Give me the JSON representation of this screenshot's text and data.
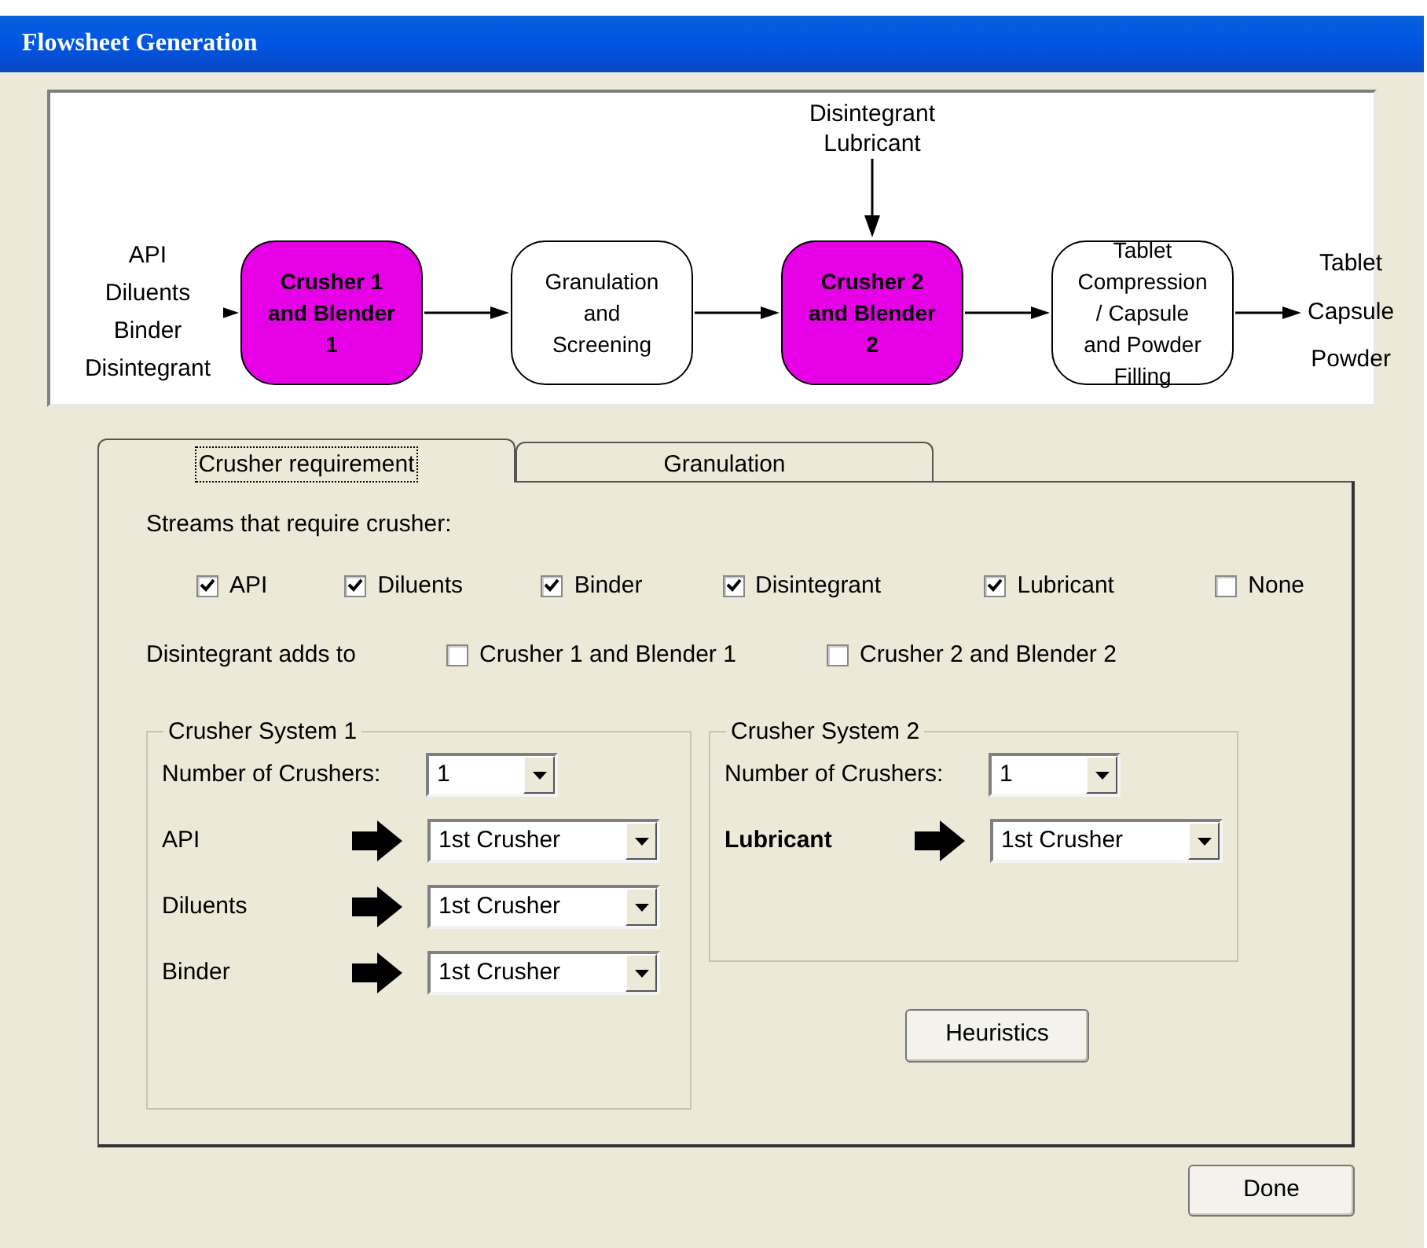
{
  "window": {
    "title": "Flowsheet Generation"
  },
  "flowsheet": {
    "inputs": [
      "API",
      "Diluents",
      "Binder",
      "Disintegrant"
    ],
    "nodes": [
      {
        "label": "Crusher 1 and Blender 1",
        "color": "#e600e6"
      },
      {
        "label": "Granulation and Screening",
        "color": "#ffffff"
      },
      {
        "label": "Crusher 2 and Blender 2",
        "color": "#e600e6",
        "top_inputs": [
          "Disintegrant",
          "Lubricant"
        ]
      },
      {
        "label": "Tablet Compression / Capsule and Powder Filling",
        "color": "#ffffff"
      }
    ],
    "outputs": [
      "Tablet",
      "Capsule",
      "Powder"
    ]
  },
  "tabs": [
    {
      "label": "Crusher requirement",
      "selected": true
    },
    {
      "label": "Granulation",
      "selected": false
    }
  ],
  "streams": {
    "label": "Streams that require crusher:",
    "options": [
      {
        "label": "API",
        "checked": true
      },
      {
        "label": "Diluents",
        "checked": true
      },
      {
        "label": "Binder",
        "checked": true
      },
      {
        "label": "Disintegrant",
        "checked": true
      },
      {
        "label": "Lubricant",
        "checked": true
      },
      {
        "label": "None",
        "checked": false
      }
    ]
  },
  "disintegrant_adds_to": {
    "label": "Disintegrant adds to",
    "options": [
      {
        "label": "Crusher 1 and Blender 1",
        "checked": false
      },
      {
        "label": "Crusher 2 and Blender 2",
        "checked": false
      }
    ]
  },
  "crusher_systems": [
    {
      "title": "Crusher System 1",
      "count_label": "Number of Crushers:",
      "count": "1",
      "assignments": [
        {
          "stream": "API",
          "bold": false,
          "crusher": "1st Crusher"
        },
        {
          "stream": "Diluents",
          "bold": false,
          "crusher": "1st Crusher"
        },
        {
          "stream": "Binder",
          "bold": false,
          "crusher": "1st Crusher"
        }
      ]
    },
    {
      "title": "Crusher System 2",
      "count_label": "Number of Crushers:",
      "count": "1",
      "assignments": [
        {
          "stream": "Lubricant",
          "bold": true,
          "crusher": "1st Crusher"
        }
      ]
    }
  ],
  "heuristics_button": "Heuristics",
  "done_button": "Done"
}
